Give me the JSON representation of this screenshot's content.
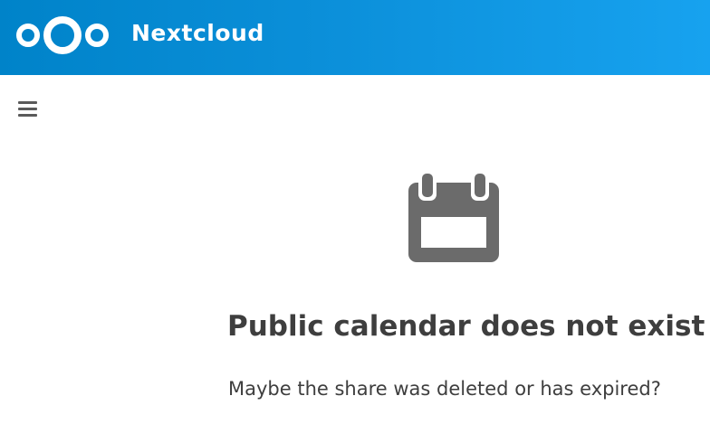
{
  "header": {
    "app_name": "Nextcloud",
    "logo_icon": "nextcloud-logo-icon",
    "gradient_start": "#0083c9",
    "gradient_end": "#17a2ef"
  },
  "navigation": {
    "menu_icon": "hamburger-menu-icon"
  },
  "empty_state": {
    "icon": "calendar-icon",
    "icon_color": "#6b6b6b",
    "title": "Public calendar does not exist",
    "message": "Maybe the share was deleted or has expired?"
  }
}
